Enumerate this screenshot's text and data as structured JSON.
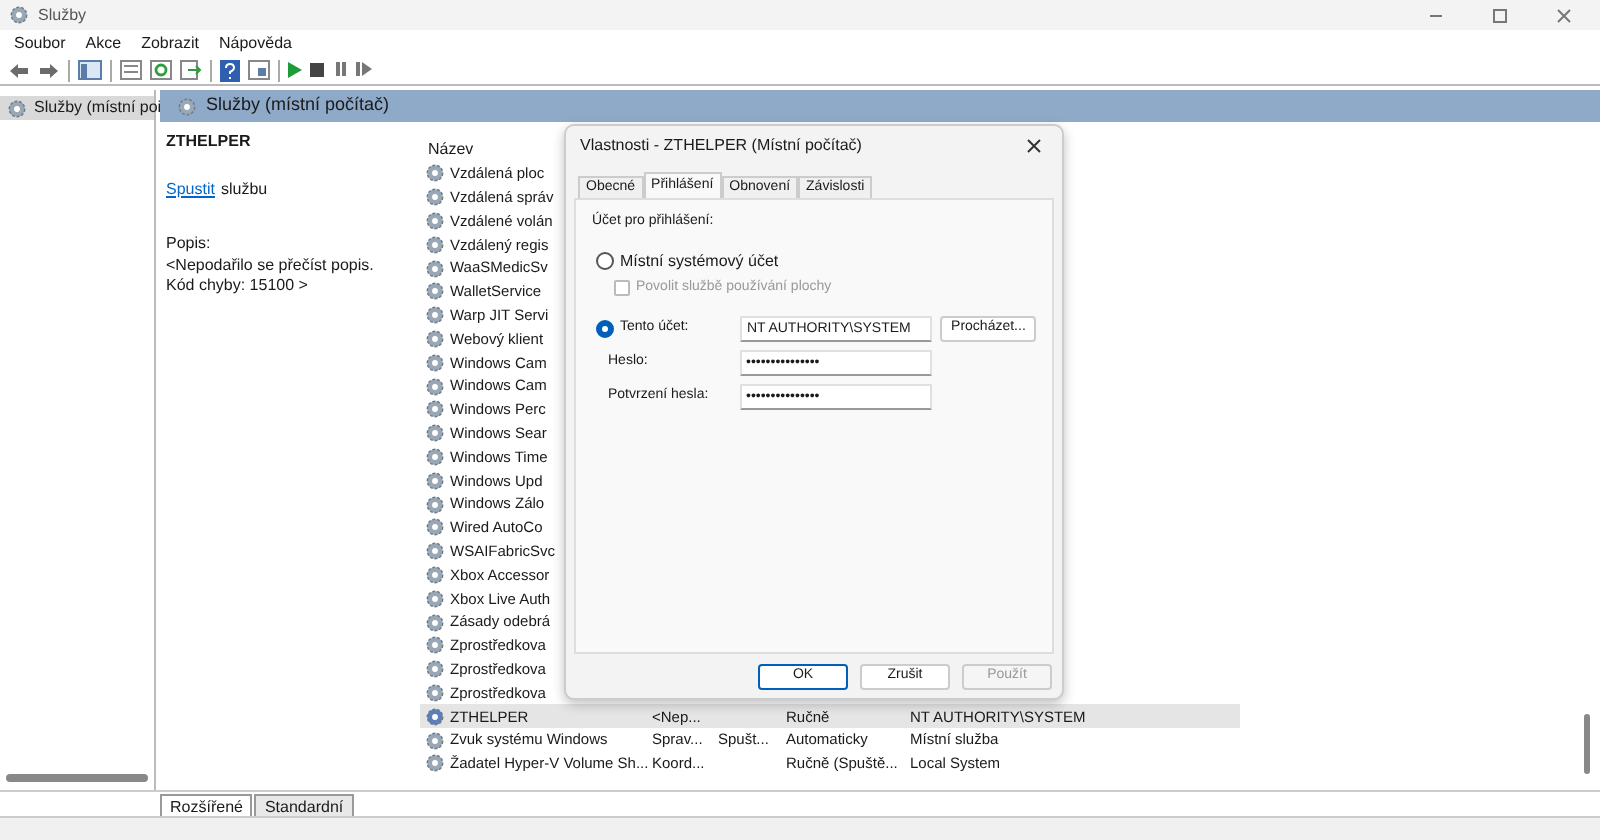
{
  "window": {
    "title": "Služby"
  },
  "menu": [
    "Soubor",
    "Akce",
    "Zobrazit",
    "Nápověda"
  ],
  "tree": [
    {
      "label": "Služby (místní poi",
      "selected": true
    }
  ],
  "panel": {
    "title": "Služby (místní počítač)",
    "service_name": "ZTHELPER",
    "action_link": "Spustit",
    "action_text": "službu",
    "description_label": "Popis:",
    "description": "<Nepodařilo se přečíst popis. Kód chyby: 15100 >"
  },
  "list": {
    "columns": [
      "Název"
    ],
    "rows": [
      {
        "name": "Vzdálená ploc",
        "selected": false
      },
      {
        "name": "Vzdálená správ",
        "selected": false
      },
      {
        "name": "Vzdálené volán",
        "selected": false
      },
      {
        "name": "Vzdálený regis",
        "selected": false
      },
      {
        "name": "WaaSMedicSv",
        "selected": false
      },
      {
        "name": "WalletService",
        "selected": false
      },
      {
        "name": "Warp JIT Servi",
        "selected": false
      },
      {
        "name": "Webový klient",
        "selected": false
      },
      {
        "name": "Windows Cam",
        "selected": false
      },
      {
        "name": "Windows Cam",
        "selected": false
      },
      {
        "name": "Windows Perc",
        "selected": false
      },
      {
        "name": "Windows Sear",
        "selected": false
      },
      {
        "name": "Windows Time",
        "selected": false
      },
      {
        "name": "Windows Upd",
        "selected": false
      },
      {
        "name": "Windows Zálo",
        "selected": false
      },
      {
        "name": "Wired AutoCo",
        "selected": false
      },
      {
        "name": "WSAIFabricSvc",
        "selected": false
      },
      {
        "name": "Xbox Accessor",
        "selected": false
      },
      {
        "name": "Xbox Live Auth",
        "selected": false
      },
      {
        "name": "Zásady odebrá",
        "selected": false
      },
      {
        "name": "Zprostředkova",
        "selected": false
      },
      {
        "name": "Zprostředkova",
        "selected": false
      },
      {
        "name": "Zprostředkova",
        "selected": false
      },
      {
        "name": "ZTHELPER",
        "description": "<Nep...",
        "startup": "Ručně",
        "logon": "NT AUTHORITY\\SYSTEM",
        "selected": true
      },
      {
        "name": "Zvuk systému Windows",
        "description": "Sprav...",
        "status": "Spušt...",
        "startup": "Automaticky",
        "logon": "Místní služba",
        "selected": false
      },
      {
        "name": "Žadatel Hyper-V Volume Sh...",
        "description": "Koord...",
        "startup": "Ručně (Spuště...",
        "logon": "Local System",
        "selected": false
      }
    ]
  },
  "dialog": {
    "title": "Vlastnosti - ZTHELPER (Místní počítač)",
    "tabs": [
      {
        "label": "Obecné",
        "selected": false
      },
      {
        "label": "Přihlášení",
        "selected": true
      },
      {
        "label": "Obnovení",
        "selected": false
      },
      {
        "label": "Závislosti",
        "selected": false
      }
    ],
    "group_label": "Účet pro přihlášení:",
    "local_account": {
      "label": "Místní systémový účet",
      "selected": false
    },
    "desktop_checkbox": {
      "label": "Povolit službě používání plochy",
      "checked": false,
      "disabled": true
    },
    "this_account": {
      "label": "Tento účet:",
      "selected": true,
      "value": "NT AUTHORITY\\SYSTEM"
    },
    "browse_button": "Procházet...",
    "password": {
      "label": "Heslo:",
      "value": "•••••••••••••••"
    },
    "confirm": {
      "label": "Potvrzení hesla:",
      "value": "•••••••••••••••"
    },
    "buttons": [
      {
        "label": "OK",
        "default": true,
        "disabled": false
      },
      {
        "label": "Zrušit",
        "default": false,
        "disabled": false
      },
      {
        "label": "Použít",
        "default": false,
        "disabled": true
      }
    ]
  },
  "bottom_tabs": [
    {
      "label": "Rozšířené",
      "selected": true
    },
    {
      "label": "Standardní",
      "selected": false
    }
  ]
}
